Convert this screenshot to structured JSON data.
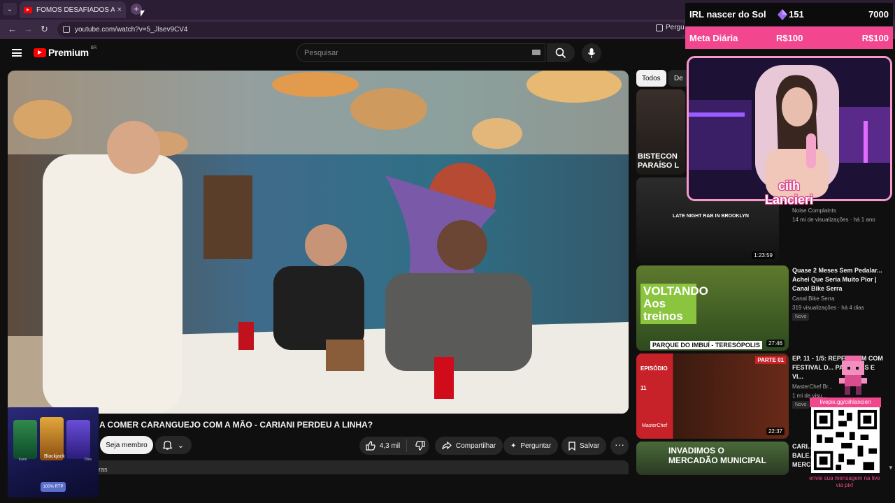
{
  "browser": {
    "tab_title": "FOMOS DESAFIADOS A COMER",
    "tab_close": "×",
    "new_tab": "+",
    "url": "youtube.com/watch?v=5_Jlsev9CV4",
    "side_chip": "Pergu"
  },
  "youtube": {
    "logo_text": "Premium",
    "logo_country": "BR",
    "search_placeholder": "Pesquisar"
  },
  "video": {
    "title": "A COMER CARANGUEJO COM A MÃO - CARIANI PERDEU A LINHA?",
    "member_button": "Seja membro",
    "likes": "4,3 mil",
    "share": "Compartilhar",
    "ask": "Perguntar",
    "save": "Salvar",
    "desc_fragment": "ras"
  },
  "ad": {
    "game": "Blackjack",
    "left_label": "Keno",
    "right_label": "Dice",
    "rtp": "100% RTP"
  },
  "sidebar": {
    "chips": [
      "Todos",
      "De"
    ],
    "videos": [
      {
        "thumb_text": "BISTECON PARAÍSO L",
        "title": "",
        "channel": "",
        "meta": "",
        "duration": "",
        "novo": ""
      },
      {
        "thumb_text": "LATE NIGHT R&B IN BROOKLYN",
        "title": "",
        "channel": "Noise Complaints",
        "meta": "14 mi de visualizações · há 1 ano",
        "duration": "1:23:59",
        "novo": ""
      },
      {
        "thumb_text": "VOLTANDO Aos treinos",
        "thumb_sub": "PARQUE DO IMBUÍ - TERESÓPOLIS",
        "title": "Quase 2 Meses Sem Pedalar... Achei Que Seria Muito Pior | Canal Bike Serra",
        "channel": "Canal Bike Serra",
        "meta": "319 visualizações · há 4 dias",
        "duration": "27:46",
        "novo": "Novo"
      },
      {
        "thumb_text": "EPISÓDIO 11",
        "thumb_sub": "PARTE 01",
        "thumb_brand": "MasterChef",
        "title": "EP. 11 - 1/5: REPE... GEM COM FESTIVAL D... PARINTINS E VI...",
        "channel": "MasterChef Br...",
        "meta": "1 mi de visu...",
        "duration": "22:37",
        "novo": "Novo"
      },
      {
        "thumb_text": "INVADIMOS O MERCADÃO MUNICIPAL",
        "title": "CARI... BALE... MERC...",
        "channel": "",
        "meta": "",
        "duration": "",
        "novo": ""
      }
    ]
  },
  "stream": {
    "goal_name": "IRL nascer do Sol",
    "goal_count": "151",
    "goal_target": "7000",
    "meta_name": "Meta Diária",
    "meta_current": "R$100",
    "meta_target": "R$100",
    "streamer_line1": "ciih",
    "streamer_line2": "Lancieri",
    "pix_url": "livepix.gg/ciihlancieri",
    "pix_note": "envie sua mensagem na live via pix!"
  },
  "colors": {
    "accent_pink": "#f2468f",
    "yt_red": "#ff0000",
    "bg": "#0f0f0f"
  }
}
